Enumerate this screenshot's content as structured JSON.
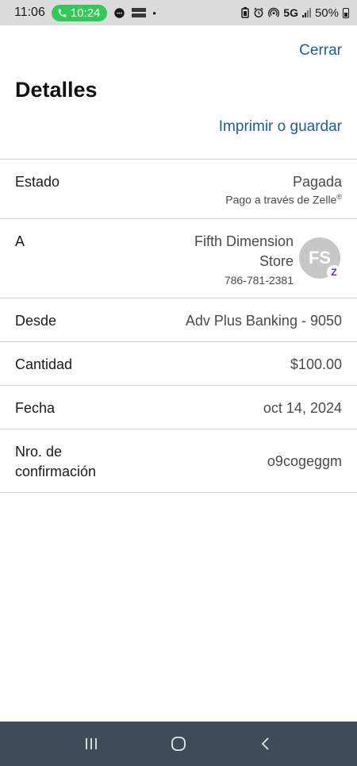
{
  "status_bar": {
    "time": "11:06",
    "call_time": "10:24",
    "network": "5G",
    "battery": "50%",
    "icons": [
      "phone-icon",
      "chat-icon",
      "temu-icon",
      "dot-icon",
      "battery-saver-icon",
      "alarm-icon",
      "hotspot-icon",
      "signal-icon",
      "battery-icon"
    ]
  },
  "header": {
    "close_label": "Cerrar",
    "title": "Detalles",
    "print_label": "Imprimir o guardar"
  },
  "details": {
    "estado": {
      "label": "Estado",
      "value": "Pagada",
      "sub": "Pago a través de Zelle",
      "sub_mark": "®"
    },
    "a": {
      "label": "A",
      "name_line1": "Fifth Dimension",
      "name_line2": "Store",
      "phone": "786-781-2381",
      "initials": "FS",
      "badge": "Z"
    },
    "desde": {
      "label": "Desde",
      "value": "Adv Plus Banking - 9050"
    },
    "cantidad": {
      "label": "Cantidad",
      "value": "$100.00"
    },
    "fecha": {
      "label": "Fecha",
      "value": "oct 14, 2024"
    },
    "confirmacion": {
      "label_line1": "Nro. de",
      "label_line2": "confirmación",
      "value": "o9cogeggm"
    }
  },
  "colors": {
    "link": "#1f5c99",
    "call_pill": "#34c759",
    "nav_bar": "#3f4b57",
    "zelle": "#6d1ed4"
  }
}
